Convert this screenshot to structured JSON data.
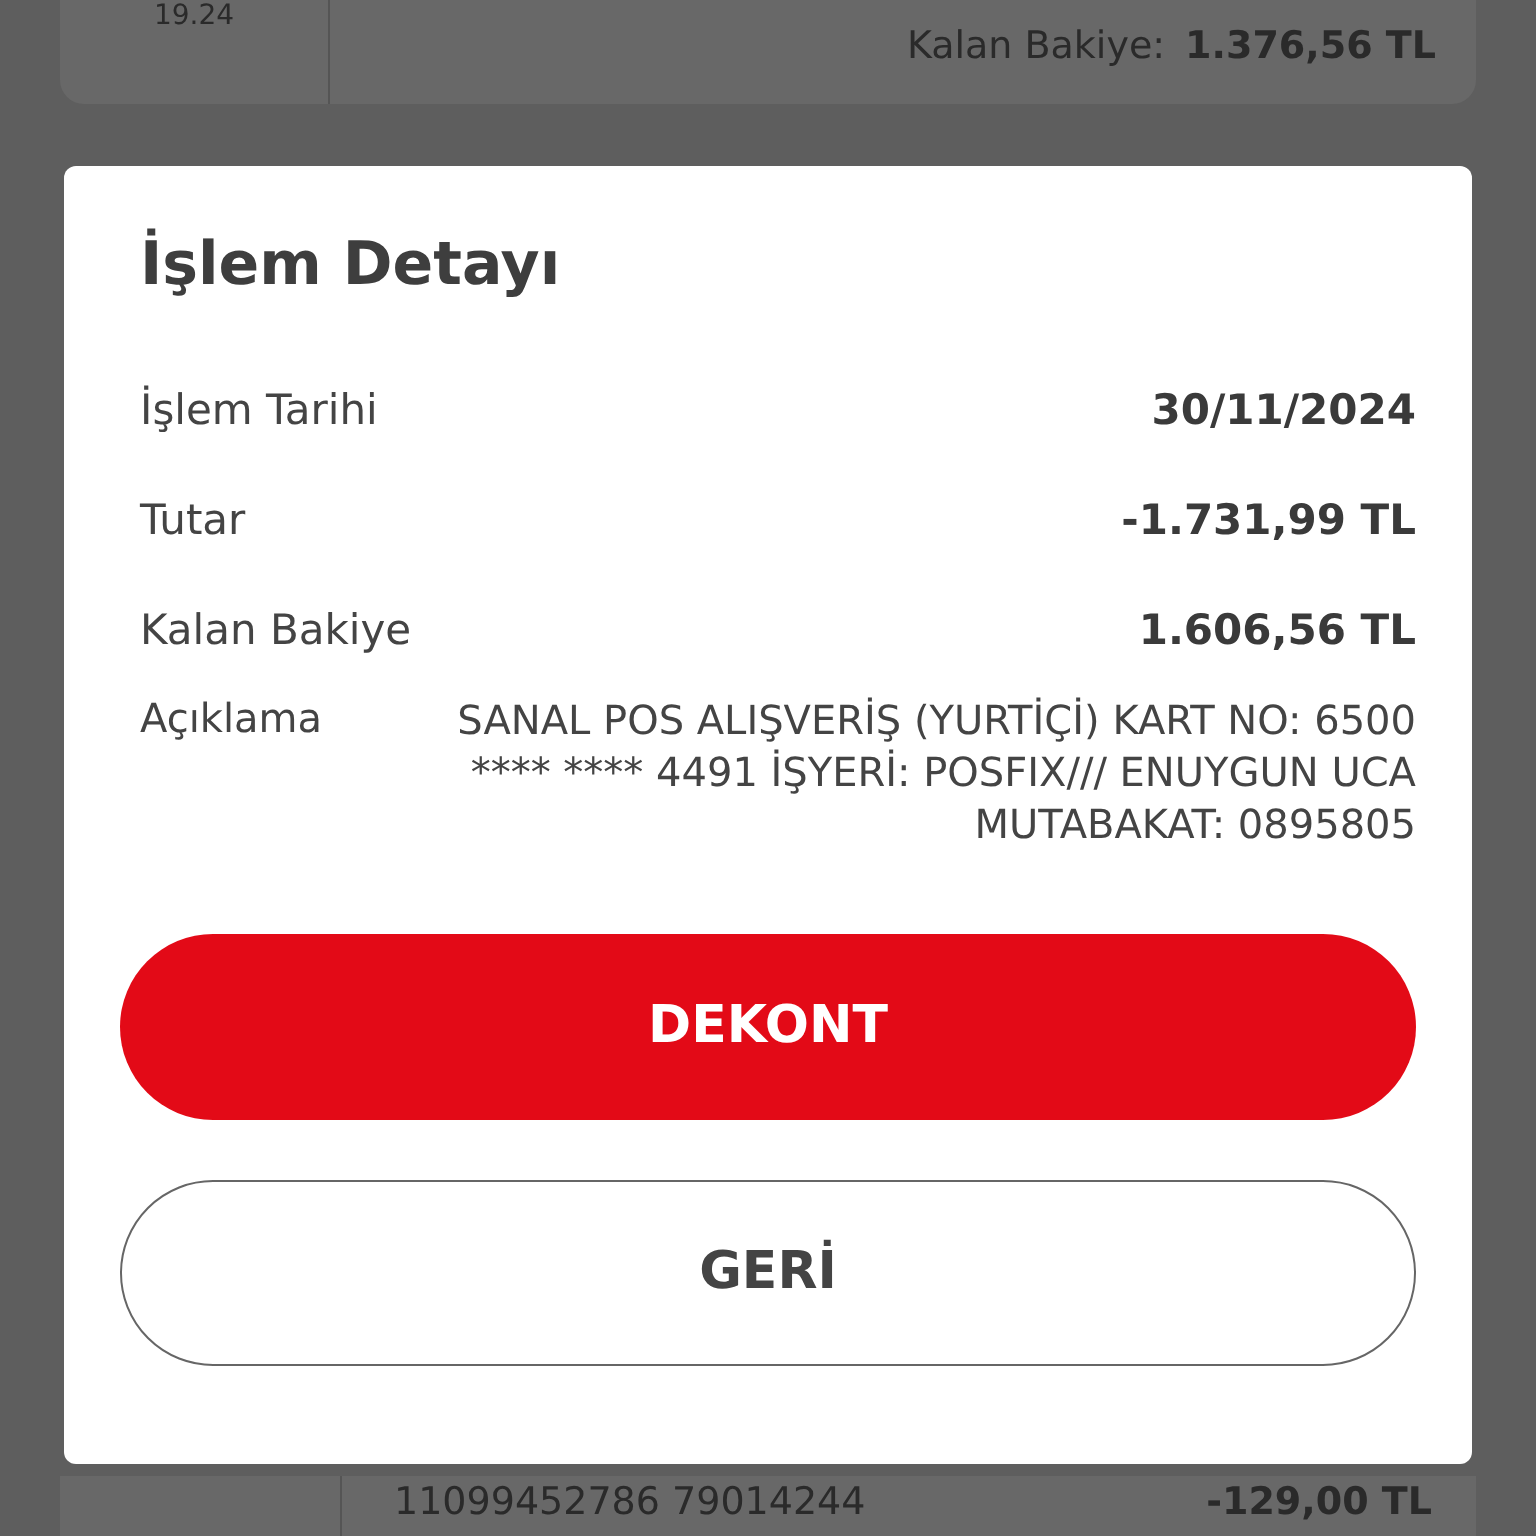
{
  "background_top": {
    "time": "19.24",
    "balance_label": "Kalan Bakiye:",
    "balance_value": "1.376,56 TL"
  },
  "dialog": {
    "title": "İşlem Detayı",
    "rows": [
      {
        "label": "İşlem Tarihi",
        "value": "30/11/2024"
      },
      {
        "label": "Tutar",
        "value": "-1.731,99 TL"
      },
      {
        "label": "Kalan Bakiye",
        "value": "1.606,56 TL"
      }
    ],
    "description": {
      "label": "Açıklama",
      "value": "SANAL POS ALIŞVERİŞ (YURTİÇİ) KART NO: 6500 **** **** 4491 İŞYERİ: POSFIX/// ENUYGUN UCA MUTABAKAT: 0895805"
    },
    "buttons": [
      {
        "label": "DEKONT",
        "kind": "primary"
      },
      {
        "label": "GERİ",
        "kind": "secondary"
      }
    ]
  },
  "background_bottom": {
    "reference": "11099452786 79014244",
    "amount": "-129,00 TL"
  }
}
